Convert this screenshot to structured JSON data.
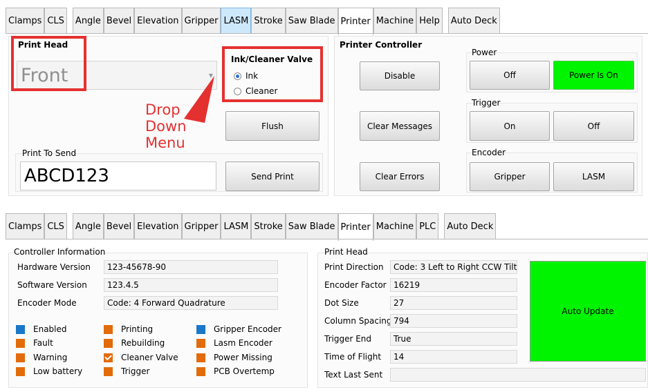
{
  "top_tabs": [
    "Clamps",
    "CLS",
    "Angle",
    "Bevel",
    "Elevation",
    "Gripper",
    "LASM",
    "Stroke",
    "Saw Blade",
    "Printer",
    "Machine",
    "Help",
    "Auto Deck"
  ],
  "bottom_tabs": [
    "Clamps",
    "CLS",
    "Angle",
    "Bevel",
    "Elevation",
    "Gripper",
    "LASM",
    "Stroke",
    "Saw Blade",
    "Printer",
    "Machine",
    "PLC",
    "Auto Deck"
  ],
  "top_panel": {
    "print_head": {
      "title": "Print Head",
      "selected": "Front"
    },
    "valve": {
      "title": "Ink/Cleaner Valve",
      "options": [
        "Ink",
        "Cleaner"
      ],
      "selected": "Ink"
    },
    "annotation": "Drop\nDown\nMenu",
    "annotation_lines": [
      "Drop",
      "Down",
      "Menu"
    ],
    "flush_button": "Flush",
    "print_to_send": {
      "label": "Print To Send",
      "value": "ABCD123"
    },
    "send_print_button": "Send Print",
    "printer_controller": {
      "title": "Printer Controller",
      "disable_button": "Disable",
      "clear_messages_button": "Clear Messages",
      "clear_errors_button": "Clear Errors",
      "power": {
        "label": "Power",
        "off_button": "Off",
        "status_button": "Power Is On"
      },
      "trigger": {
        "label": "Trigger",
        "on_button": "On",
        "off_button": "Off"
      },
      "encoder": {
        "label": "Encoder",
        "gripper_button": "Gripper",
        "lasm_button": "LASM"
      }
    }
  },
  "bottom_panel": {
    "controller_info": {
      "title": "Controller Information",
      "rows": [
        {
          "label": "Hardware Version",
          "value": "123-45678-90"
        },
        {
          "label": "Software Version",
          "value": "123.4.5"
        },
        {
          "label": "Encoder Mode",
          "value": "Code: 4 Forward Quadrature"
        }
      ],
      "indicators": [
        {
          "label": "Enabled",
          "color": "blue"
        },
        {
          "label": "Fault",
          "color": "orange"
        },
        {
          "label": "Warning",
          "color": "orange"
        },
        {
          "label": "Low battery",
          "color": "orange"
        },
        {
          "label": "Printing",
          "color": "orange"
        },
        {
          "label": "Rebuilding",
          "color": "orange"
        },
        {
          "label": "Cleaner Valve",
          "color": "orange",
          "checked": true
        },
        {
          "label": "Trigger",
          "color": "orange"
        },
        {
          "label": "Gripper Encoder",
          "color": "blue"
        },
        {
          "label": "Lasm Encoder",
          "color": "orange"
        },
        {
          "label": "Power Missing",
          "color": "orange"
        },
        {
          "label": "PCB Overtemp",
          "color": "orange"
        }
      ]
    },
    "print_head": {
      "title": "Print Head",
      "rows": [
        {
          "label": "Print Direction",
          "value": "Code: 3 Left to Right CCW Tilt"
        },
        {
          "label": "Encoder Factor",
          "value": "16219"
        },
        {
          "label": "Dot Size",
          "value": "27"
        },
        {
          "label": "Column Spacing",
          "value": "794"
        },
        {
          "label": "Trigger End",
          "value": "True"
        },
        {
          "label": "Time of Flight",
          "value": "14"
        },
        {
          "label": "Text Last Sent",
          "value": ""
        }
      ],
      "auto_update_button": "Auto Update"
    }
  },
  "colors": {
    "accent_green": "#00f400",
    "annotation_red": "#e53030",
    "indicator_blue": "#1a78c8",
    "indicator_orange": "#e26b0a",
    "lasm_tab_blue": "#cde8fb"
  }
}
